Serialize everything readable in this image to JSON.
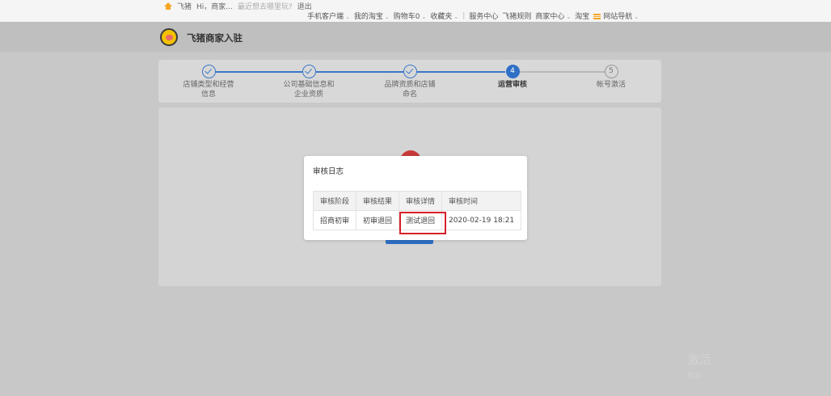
{
  "topbar": {
    "site_name": "飞猪",
    "greeting": "Hi，商家...",
    "search_hint": "最近想去哪里玩?",
    "logout": "退出",
    "nav": [
      {
        "label": "手机客户端",
        "dropdown": true
      },
      {
        "label": "我的淘宝",
        "dropdown": true
      },
      {
        "label": "购物车0",
        "dropdown": true
      },
      {
        "label": "收藏夹",
        "dropdown": true
      },
      {
        "label": "服务中心",
        "dropdown": false
      },
      {
        "label": "飞猪规则",
        "dropdown": false
      },
      {
        "label": "商家中心",
        "dropdown": true
      },
      {
        "label": "淘宝",
        "dropdown": false
      },
      {
        "label": "网站导航",
        "dropdown": true
      }
    ],
    "caret": "⌄"
  },
  "header": {
    "title": "飞猪商家入驻"
  },
  "steps": [
    {
      "number": "1",
      "label": "店铺类型和经营信息",
      "status": "done"
    },
    {
      "number": "2",
      "label": "公司基础信息和企业资质",
      "status": "done"
    },
    {
      "number": "3",
      "label": "品牌资质和店铺命名",
      "status": "done"
    },
    {
      "number": "4",
      "label": "运营审核",
      "status": "current"
    },
    {
      "number": "5",
      "label": "帐号激活",
      "status": "future"
    }
  ],
  "modal": {
    "title": "审核日志",
    "columns": [
      "审核阶段",
      "审核结果",
      "审核详情",
      "审核时间"
    ],
    "rows": [
      [
        "招商初审",
        "初审退回",
        "测试退回",
        "2020-02-19 18:21"
      ]
    ]
  },
  "watermark": {
    "line1": "激活",
    "line2": "转到"
  },
  "colors": {
    "accent_blue": "#2f6fc6",
    "highlight_red": "#d8202a",
    "brand_yellow": "#f2c200"
  }
}
